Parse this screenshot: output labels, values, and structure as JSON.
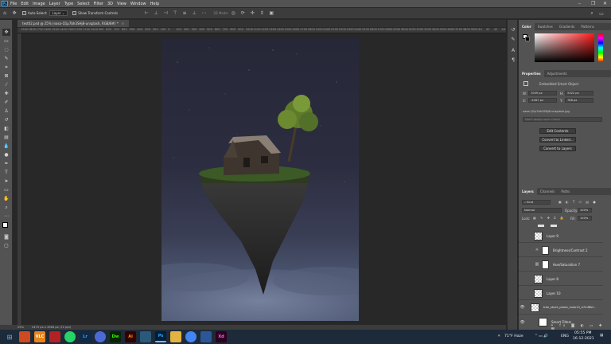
{
  "menu": [
    "File",
    "Edit",
    "Image",
    "Layer",
    "Type",
    "Select",
    "Filter",
    "3D",
    "View",
    "Window",
    "Help"
  ],
  "app_logo": "Ps",
  "options": {
    "auto_select": "Auto-Select:",
    "layer_select": "Layer",
    "show_transform": "Show Transform Controls",
    "mode_3d": "3D Mode:"
  },
  "document_tab": {
    "title": "test02.psd @ 25% (nasa-Q1p7bh3SHj8-unsplash, RGB/8#) *",
    "close": "×"
  },
  "ruler_marks": [
    "1900",
    "1800",
    "1700",
    "1600",
    "1500",
    "1400",
    "1300",
    "1200",
    "1100",
    "1000",
    "900",
    "800",
    "700",
    "600",
    "500",
    "400",
    "300",
    "200",
    "100",
    "0",
    "100",
    "200",
    "300",
    "400",
    "500",
    "600",
    "700",
    "800",
    "900",
    "1000",
    "1100",
    "1200",
    "1300",
    "1400",
    "1500",
    "1600",
    "1700",
    "1800",
    "1900",
    "2000",
    "2100",
    "2200",
    "2300",
    "2400",
    "2500",
    "2600",
    "2700",
    "2800",
    "2900",
    "3000",
    "3100",
    "3200",
    "3300",
    "3400",
    "3500",
    "3600",
    "3700",
    "3800",
    "3900",
    "40",
    "41",
    "42",
    "43"
  ],
  "status": {
    "zoom": "25%",
    "doc_size": "2475 px x 3564 px (72 ppi)"
  },
  "color_panel": {
    "tabs": [
      "Color",
      "Swatches",
      "Gradients",
      "Patterns"
    ],
    "hue_color": "#ff1a1a"
  },
  "properties_panel": {
    "tabs": [
      "Properties",
      "Adjustments"
    ],
    "kind": "Embedded Smart Object",
    "w_label": "W:",
    "w_value": "7009 px",
    "h_label": "H:",
    "h_value": "5322 px",
    "x_label": "X:",
    "x_value": "-3267 px",
    "y_label": "Y:",
    "y_value": "786 px",
    "filename": "nasa-Q1p7bh3SHj8-unsplash.jpg",
    "comp_placeholder": "Don't Apply Layer Comp",
    "buttons": [
      "Edit Contents",
      "Convert to Linked...",
      "Convert to Layers"
    ]
  },
  "layers_panel": {
    "tabs": [
      "Layers",
      "Channels",
      "Paths"
    ],
    "filter_kind": "Kind",
    "blend_mode": "Normal",
    "opacity_label": "Opacity:",
    "opacity_value": "100%",
    "lock_label": "Lock:",
    "fill_label": "Fill:",
    "fill_value": "100%",
    "layers": [
      {
        "name": "Layer 9",
        "type": "pixel",
        "visible": false
      },
      {
        "name": "Brightness/Contrast 2",
        "type": "adjustment",
        "visible": false
      },
      {
        "name": "Hue/Saturation 7",
        "type": "adjustment",
        "visible": false
      },
      {
        "name": "Layer 8",
        "type": "pixel",
        "visible": false
      },
      {
        "name": "Layer 10",
        "type": "pixel",
        "visible": false
      },
      {
        "name": "tree_stock_photo_mwe10_d7mf8bf...",
        "type": "smart",
        "visible": true
      },
      {
        "name": "Smart Filters",
        "type": "filters",
        "visible": true
      }
    ]
  },
  "taskbar": {
    "apps": [
      {
        "label": "",
        "color": "#cf4a1f"
      },
      {
        "label": "VLC",
        "color": "#e8841b"
      },
      {
        "label": "",
        "color": "#b22222"
      },
      {
        "label": "",
        "color": "#25d366"
      },
      {
        "label": "Lr",
        "color": "#0e2a47"
      },
      {
        "label": "",
        "color": "#4b6ad6"
      },
      {
        "label": "Dw",
        "color": "#072401"
      },
      {
        "label": "Ai",
        "color": "#330000"
      },
      {
        "label": "",
        "color": "#2a5a7a"
      },
      {
        "label": "Ps",
        "color": "#001e36"
      },
      {
        "label": "",
        "color": "#e2b340"
      },
      {
        "label": "",
        "color": "#4285f4"
      },
      {
        "label": "",
        "color": "#2b5797"
      },
      {
        "label": "Xd",
        "color": "#2e001f"
      }
    ],
    "weather": "71°F Haze",
    "lang": "ENG",
    "time": "05:55 PM",
    "date": "16-12-2021"
  }
}
